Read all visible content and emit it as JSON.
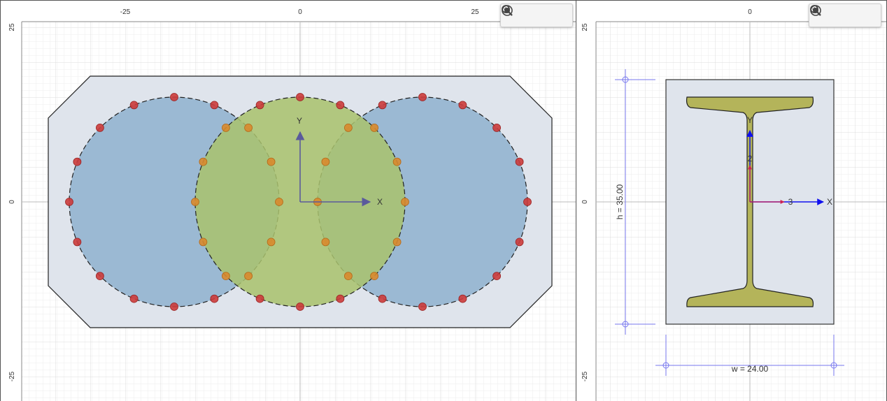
{
  "left_view": {
    "x_ticks": [
      "-25",
      "0",
      "25"
    ],
    "y_ticks": [
      "25",
      "0",
      "-25"
    ],
    "axis_x_label": "X",
    "axis_y_label": "Y"
  },
  "right_view": {
    "x_ticks": [
      "0"
    ],
    "y_ticks": [
      "25",
      "0",
      "-25"
    ],
    "axis_x_label": "X",
    "axis_y_label": "Y",
    "local_axis_2": "2",
    "local_axis_3": "3",
    "dim_height": "h = 35.00",
    "dim_width": "w = 24.00"
  },
  "toolbar": {
    "zoom_in_icon": "zoom-in-icon",
    "zoom_out_icon": "zoom-out-icon",
    "fit_icon": "fit-view-icon"
  },
  "colors": {
    "grid_minor": "#ececec",
    "grid_major": "#d6d6d6",
    "section_fill": "#dfe4ec",
    "circle_blue": "#8fb2cf",
    "circle_green": "#a9c26c",
    "rebar_red": "#cc3b3b",
    "rebar_orange": "#d98a2e",
    "beam_fill": "#b4b45a",
    "axis_color": "#5a5a9c",
    "dim_color": "#7777ee"
  }
}
